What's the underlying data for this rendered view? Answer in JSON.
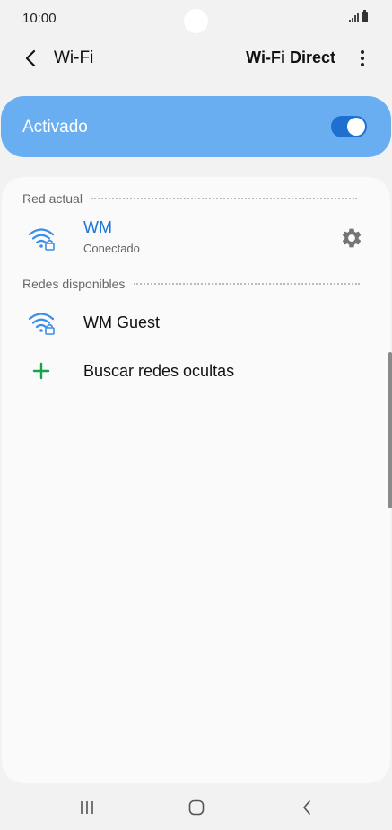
{
  "status_bar": {
    "time": "10:00"
  },
  "header": {
    "title": "Wi-Fi",
    "action_label": "Wi-Fi Direct"
  },
  "master_switch": {
    "label": "Activado",
    "on": true
  },
  "sections": {
    "current": {
      "title": "Red actual",
      "network": {
        "ssid": "WM",
        "status": "Conectado"
      }
    },
    "available": {
      "title": "Redes disponibles",
      "networks": [
        {
          "ssid": "WM Guest"
        }
      ]
    }
  },
  "add_network": {
    "label": "Buscar redes ocultas"
  },
  "icons": {
    "back": "chevron-left-icon",
    "more": "more-vert-icon",
    "wifi_locked": "wifi-lock-icon",
    "settings": "gear-icon",
    "add": "plus-icon",
    "nav_recents": "recents-icon",
    "nav_home": "home-icon",
    "nav_back": "back-icon"
  },
  "colors": {
    "accent": "#1a73d9",
    "switch_bg": "#6aaef2",
    "toggle_on": "#1f6fd1",
    "add_green": "#17a34a",
    "wifi_icon": "#3a8ee8"
  }
}
